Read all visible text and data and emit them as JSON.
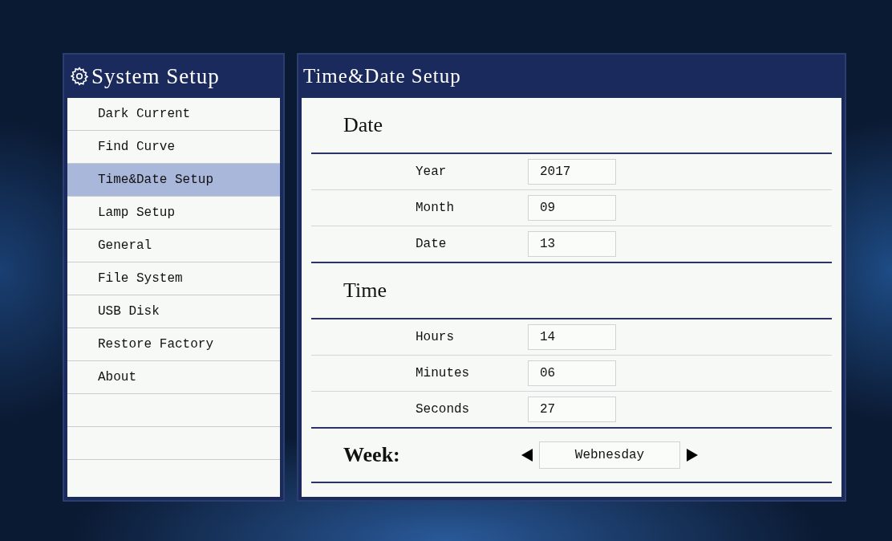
{
  "sidebar": {
    "title": "System Setup",
    "items": [
      {
        "label": "Dark Current",
        "selected": false
      },
      {
        "label": "Find Curve",
        "selected": false
      },
      {
        "label": "Time&Date Setup",
        "selected": true
      },
      {
        "label": "Lamp Setup",
        "selected": false
      },
      {
        "label": "General",
        "selected": false
      },
      {
        "label": "File System",
        "selected": false
      },
      {
        "label": "USB Disk",
        "selected": false
      },
      {
        "label": "Restore Factory",
        "selected": false
      },
      {
        "label": "About",
        "selected": false
      }
    ]
  },
  "panel": {
    "title": "Time&Date Setup",
    "sections": [
      {
        "heading": "Date",
        "fields": [
          {
            "label": "Year",
            "value": "2017"
          },
          {
            "label": "Month",
            "value": "09"
          },
          {
            "label": "Date",
            "value": "13"
          }
        ]
      },
      {
        "heading": "Time",
        "fields": [
          {
            "label": "Hours",
            "value": "14"
          },
          {
            "label": "Minutes",
            "value": "06"
          },
          {
            "label": "Seconds",
            "value": "27"
          }
        ]
      }
    ],
    "week": {
      "label": "Week:",
      "value": "Webnesday"
    }
  }
}
